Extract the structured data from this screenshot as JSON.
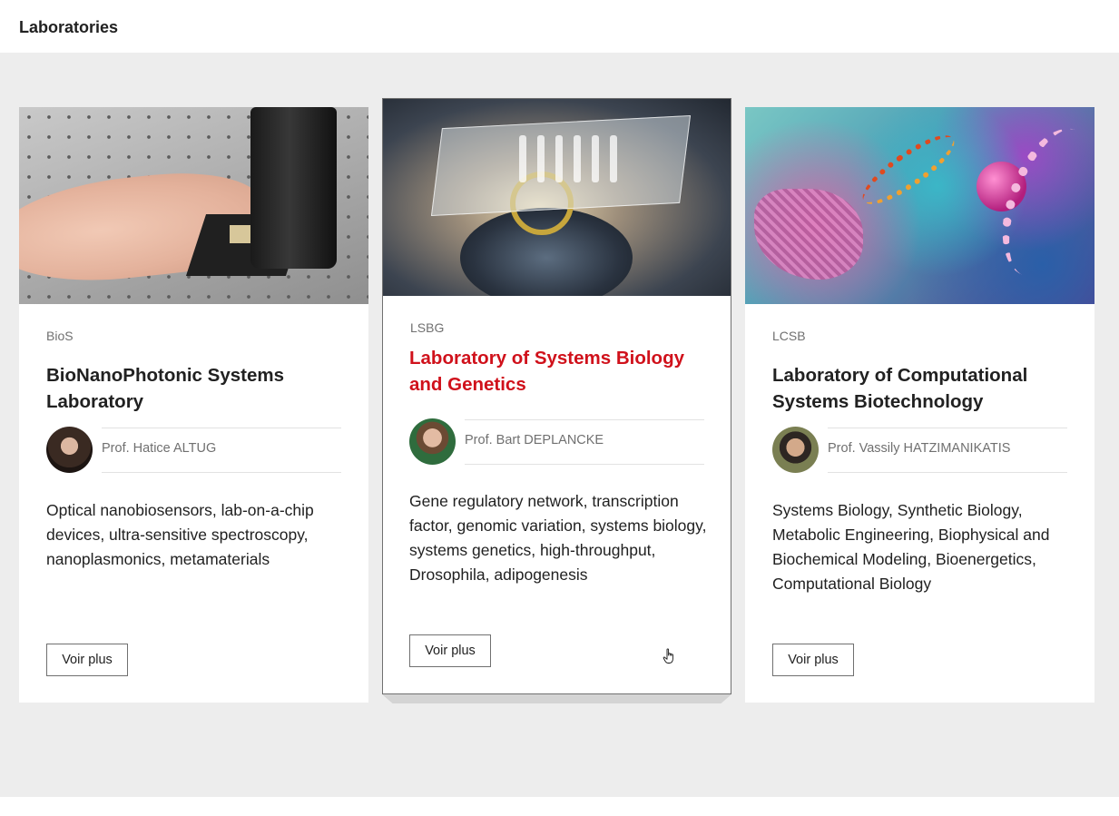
{
  "header": {
    "title": "Laboratories"
  },
  "cards": [
    {
      "acronym": "BioS",
      "title": "BioNanoPhotonic Systems Laboratory",
      "professor": "Prof. Hatice ALTUG",
      "description": "Optical nanobiosensors, lab-on-a-chip devices, ultra-sensitive spectroscopy, nanoplasmonics, metamaterials",
      "button_label": "Voir plus",
      "image_icon": "lab-photo"
    },
    {
      "acronym": "LSBG",
      "title": "Laboratory of Systems Biology and Genetics",
      "professor": "Prof. Bart DEPLANCKE",
      "description": "Gene regulatory network, transcription factor, genomic variation, systems biology, systems genetics, high-throughput, Drosophila, adipogenesis",
      "button_label": "Voir plus",
      "image_icon": "lab-photo",
      "hovered": true,
      "title_color": "#d0111b"
    },
    {
      "acronym": "LCSB",
      "title": "Laboratory of Computational Systems Biotechnology",
      "professor": "Prof. Vassily HATZIMANIKATIS",
      "description": "Systems Biology, Synthetic Biology, Metabolic Engineering, Biophysical and Biochemical Modeling, Bioenergetics, Computational Biology",
      "button_label": "Voir plus",
      "image_icon": "lab-photo"
    }
  ],
  "colors": {
    "background": "#ededed",
    "card": "#ffffff",
    "accent": "#d0111b",
    "text": "#212121",
    "muted": "#707070"
  },
  "cursor": {
    "icon": "hand-pointer-icon"
  }
}
